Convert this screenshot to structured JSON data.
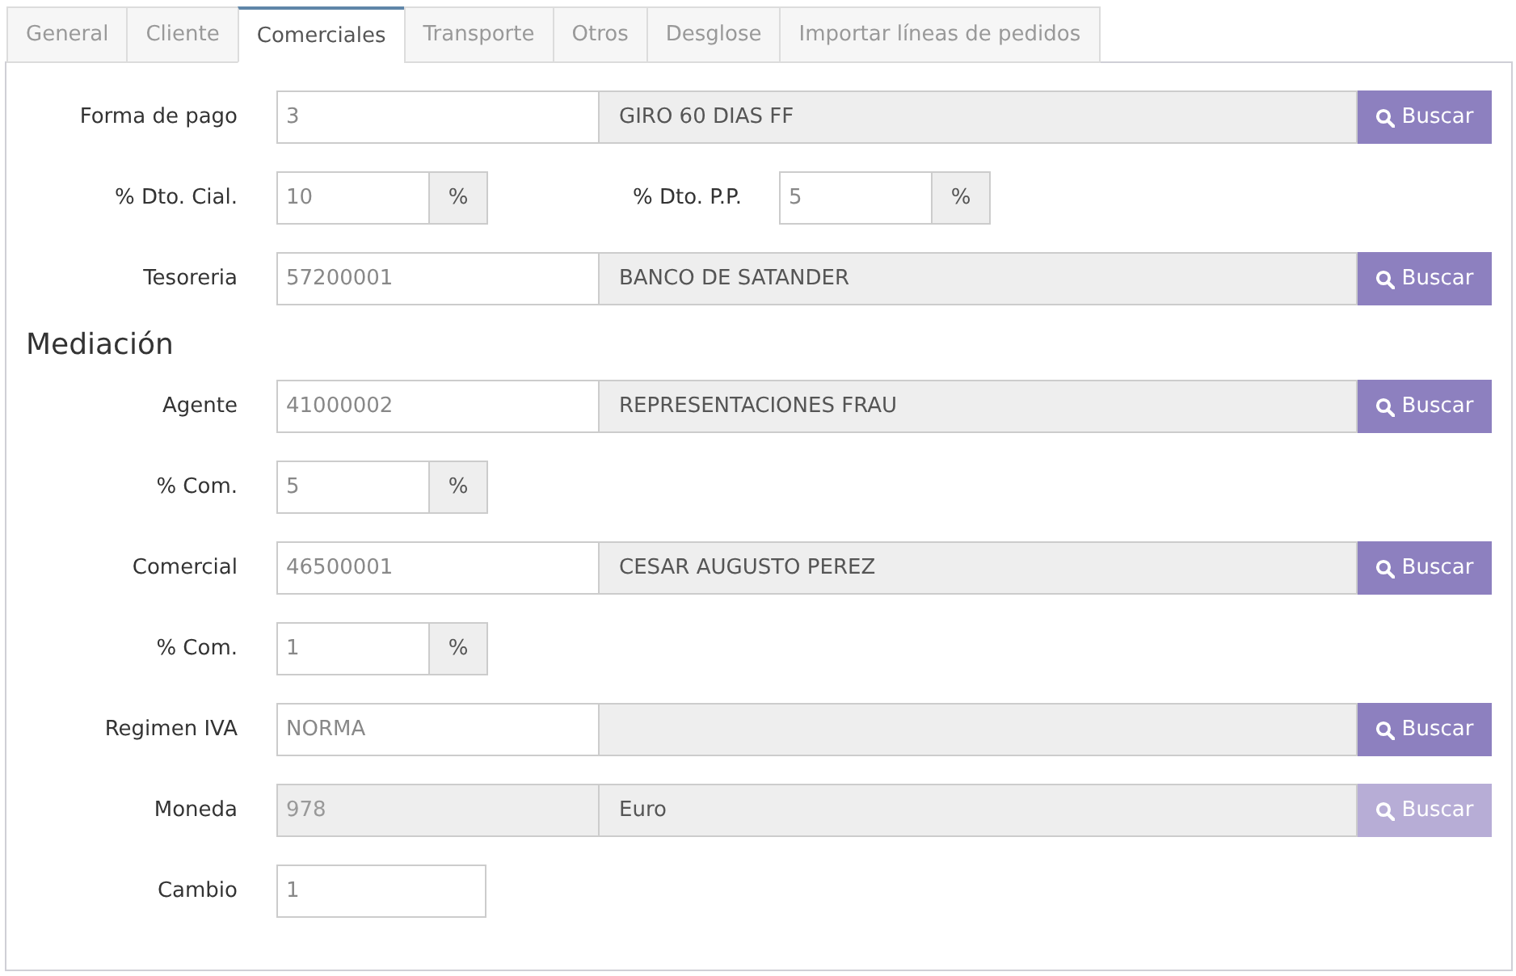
{
  "tabs": [
    {
      "label": "General",
      "selected": false
    },
    {
      "label": "Cliente",
      "selected": false
    },
    {
      "label": "Comerciales",
      "selected": true
    },
    {
      "label": "Transporte",
      "selected": false
    },
    {
      "label": "Otros",
      "selected": false
    },
    {
      "label": "Desglose",
      "selected": false
    },
    {
      "label": "Importar líneas de pedidos",
      "selected": false
    }
  ],
  "form": {
    "rows": [
      {
        "kind": "lookup",
        "label": "Forma de pago",
        "code": "3",
        "description": "GIRO 60 DIAS FF",
        "button": "Buscar",
        "disabled": false
      },
      {
        "kind": "percent",
        "fields": [
          {
            "label": "% Dto. Cial.",
            "value": "10",
            "unit": "%"
          },
          {
            "label": "% Dto. P.P.",
            "value": "5",
            "unit": "%"
          }
        ]
      },
      {
        "kind": "lookup",
        "label": "Tesoreria",
        "code": "57200001",
        "description": "BANCO DE SATANDER",
        "button": "Buscar",
        "disabled": false
      },
      {
        "kind": "heading",
        "text": "Mediación"
      },
      {
        "kind": "lookup",
        "label": "Agente",
        "code": "41000002",
        "description": "REPRESENTACIONES FRAU",
        "button": "Buscar",
        "disabled": false
      },
      {
        "kind": "percent",
        "fields": [
          {
            "label": "% Com.",
            "value": "5",
            "unit": "%"
          }
        ]
      },
      {
        "kind": "lookup",
        "label": "Comercial",
        "code": "46500001",
        "description": "CESAR AUGUSTO PEREZ",
        "button": "Buscar",
        "disabled": false
      },
      {
        "kind": "percent",
        "fields": [
          {
            "label": "% Com.",
            "value": "1",
            "unit": "%"
          }
        ]
      },
      {
        "kind": "lookup",
        "label": "Regimen IVA",
        "code": "NORMA",
        "button": "Buscar",
        "disabled": false
      },
      {
        "kind": "lookup",
        "label": "Moneda",
        "code": "978",
        "description": "Euro",
        "button": "Buscar",
        "disabled": true
      },
      {
        "kind": "text",
        "label": "Cambio",
        "value": "1"
      }
    ]
  }
}
